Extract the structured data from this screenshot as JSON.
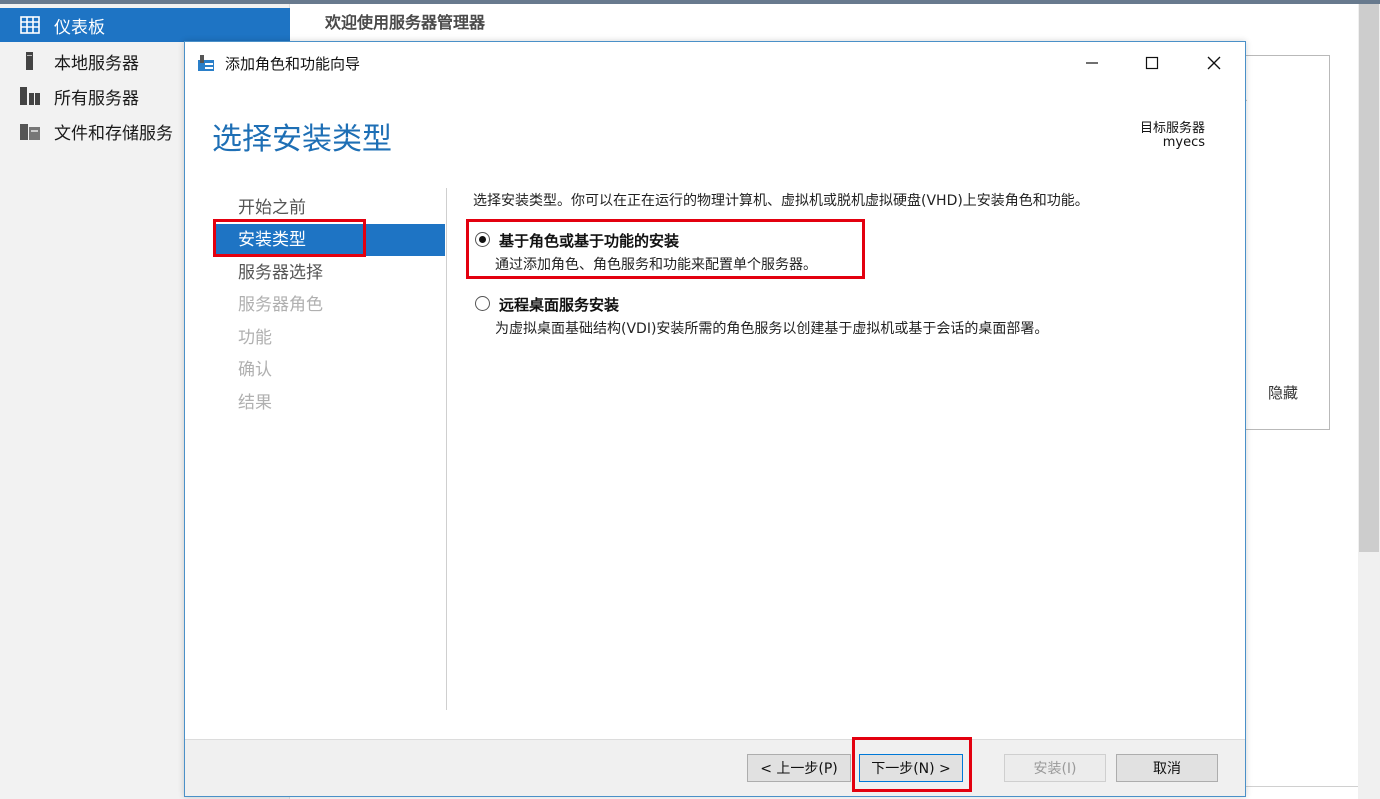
{
  "server_manager": {
    "nav": [
      {
        "label": "仪表板",
        "icon": "dashboard-icon",
        "active": true
      },
      {
        "label": "本地服务器",
        "icon": "local-server-icon",
        "active": false
      },
      {
        "label": "所有服务器",
        "icon": "all-servers-icon",
        "active": false
      },
      {
        "label": "文件和存储服务",
        "icon": "file-storage-icon",
        "active": false
      }
    ],
    "welcome_title": "欢迎使用服务器管理器",
    "hide_label": "隐藏"
  },
  "dialog": {
    "title": "添加角色和功能向导",
    "heading": "选择安装类型",
    "target_label": "目标服务器",
    "target_value": "myecs",
    "steps": [
      {
        "label": "开始之前",
        "state": "normal"
      },
      {
        "label": "安装类型",
        "state": "active"
      },
      {
        "label": "服务器选择",
        "state": "normal"
      },
      {
        "label": "服务器角色",
        "state": "disabled"
      },
      {
        "label": "功能",
        "state": "disabled"
      },
      {
        "label": "确认",
        "state": "disabled"
      },
      {
        "label": "结果",
        "state": "disabled"
      }
    ],
    "intro": "选择安装类型。你可以在正在运行的物理计算机、虚拟机或脱机虚拟硬盘(VHD)上安装角色和功能。",
    "options": [
      {
        "title": "基于角色或基于功能的安装",
        "desc": "通过添加角色、角色服务和功能来配置单个服务器。",
        "checked": true
      },
      {
        "title": "远程桌面服务安装",
        "desc": "为虚拟桌面基础结构(VDI)安装所需的角色服务以创建基于虚拟机或基于会话的桌面部署。",
        "checked": false
      }
    ],
    "buttons": {
      "prev": "< 上一步(P)",
      "next": "下一步(N) >",
      "install": "安装(I)",
      "cancel": "取消"
    }
  },
  "colors": {
    "accent": "#1e74c4",
    "heading": "#1e6fb5",
    "highlight": "#e3000f"
  }
}
